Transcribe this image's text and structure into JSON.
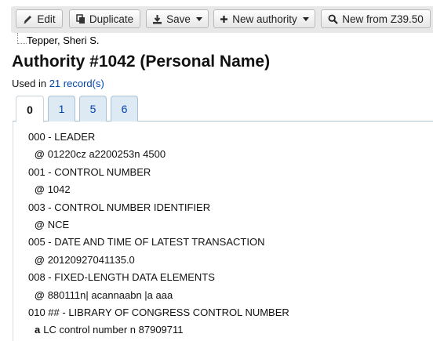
{
  "toolbar": {
    "edit_label": "Edit",
    "duplicate_label": "Duplicate",
    "save_label": "Save",
    "new_authority_label": "New authority",
    "new_from_z3950_label": "New from Z39.50"
  },
  "breadcrumb": {
    "name": "Tepper, Sheri S."
  },
  "page": {
    "title": "Authority #1042 (Personal Name)",
    "used_in_prefix": "Used in",
    "used_in_link": "21 record(s)"
  },
  "tabs": [
    {
      "label": "0",
      "active": true
    },
    {
      "label": "1",
      "active": false
    },
    {
      "label": "5",
      "active": false
    },
    {
      "label": "6",
      "active": false
    }
  ],
  "fields": [
    {
      "tag": "000 - LEADER",
      "code": "@",
      "value": "01220cz a2200253n 4500"
    },
    {
      "tag": "001 - CONTROL NUMBER",
      "code": "@",
      "value": "1042"
    },
    {
      "tag": "003 - CONTROL NUMBER IDENTIFIER",
      "code": "@",
      "value": "NCE"
    },
    {
      "tag": "005 - DATE AND TIME OF LATEST TRANSACTION",
      "code": "@",
      "value": "20120927041135.0"
    },
    {
      "tag": "008 - FIXED-LENGTH DATA ELEMENTS",
      "code": "@",
      "value": "880111n| acannaabn |a aaa"
    },
    {
      "tag": "010 ## - LIBRARY OF CONGRESS CONTROL NUMBER",
      "code": "a",
      "value": "LC control number n 87909711"
    }
  ]
}
